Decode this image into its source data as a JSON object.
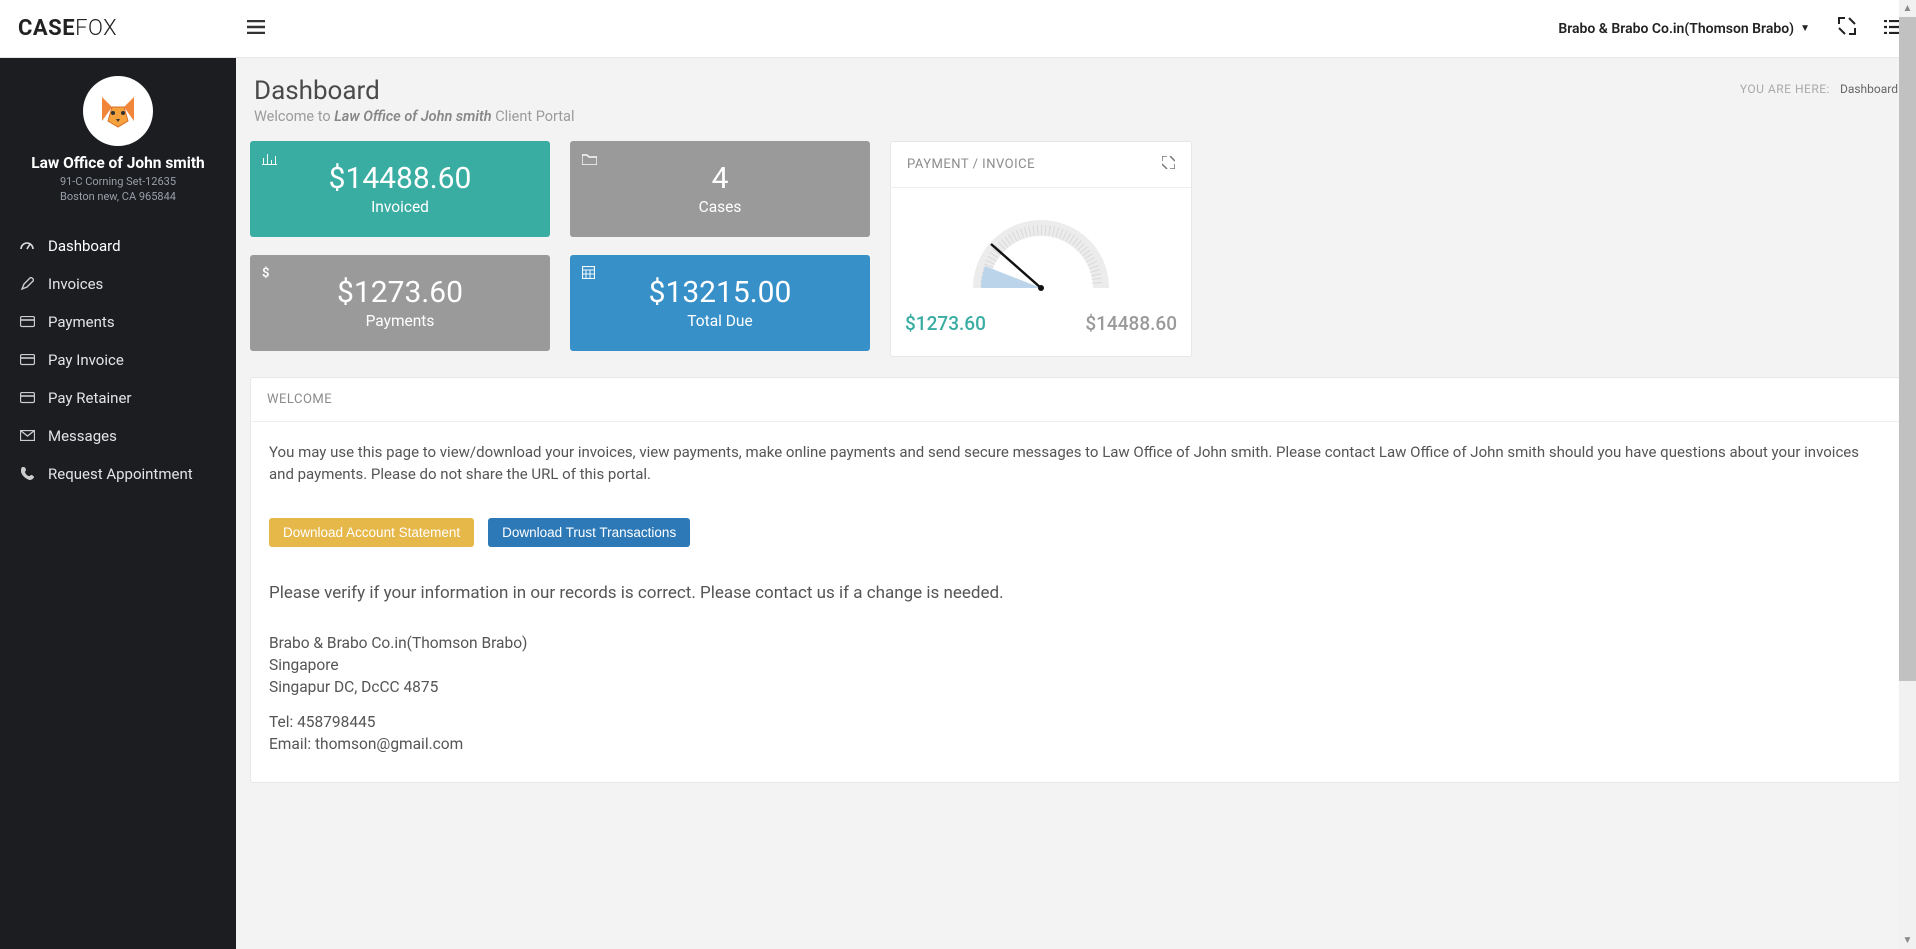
{
  "logo": {
    "bold": "CASE",
    "light": "FOX"
  },
  "header": {
    "user_label": "Brabo & Brabo Co.in(Thomson Brabo)"
  },
  "breadcrumb": {
    "label": "YOU ARE HERE:",
    "current": "Dashboard"
  },
  "page": {
    "title": "Dashboard",
    "subtitle_prefix": "Welcome to ",
    "subtitle_firm": "Law Office of John smith",
    "subtitle_suffix": " Client Portal"
  },
  "profile": {
    "firm": "Law Office of John smith",
    "addr1": "91-C Corning Set-12635",
    "addr2": "Boston new, CA 965844"
  },
  "nav": {
    "items": [
      {
        "label": "Dashboard"
      },
      {
        "label": "Invoices"
      },
      {
        "label": "Payments"
      },
      {
        "label": "Pay Invoice"
      },
      {
        "label": "Pay Retainer"
      },
      {
        "label": "Messages"
      },
      {
        "label": "Request Appointment"
      }
    ]
  },
  "stats": {
    "invoiced": {
      "value": "$14488.60",
      "label": "Invoiced"
    },
    "cases": {
      "value": "4",
      "label": "Cases"
    },
    "payments": {
      "value": "$1273.60",
      "label": "Payments"
    },
    "due": {
      "value": "$13215.00",
      "label": "Total Due"
    }
  },
  "gauge": {
    "title": "PAYMENT / INVOICE",
    "paid": "$1273.60",
    "total": "$14488.60"
  },
  "welcome": {
    "title": "WELCOME",
    "body": "You may use this page to view/download your invoices, view payments, make online payments and send secure messages to Law Office of John smith. Please contact Law Office of John smith should you have questions about your invoices and payments. Please do not share the URL of this portal.",
    "btn_statement": "Download Account Statement",
    "btn_trust": "Download Trust Transactions",
    "verify": "Please verify if your information in our records is correct. Please contact us if a change is needed.",
    "contact": {
      "name": "Brabo & Brabo Co.in(Thomson Brabo)",
      "city": "Singapore",
      "region": "Singapur DC, DcCC 4875",
      "tel": "Tel: 458798445",
      "email": "Email: thomson@gmail.com"
    }
  },
  "chart_data": {
    "type": "gauge",
    "title": "PAYMENT / INVOICE",
    "min": 0,
    "max": 14488.6,
    "value": 1273.6,
    "labels": {
      "value": "$1273.60",
      "max": "$14488.60"
    }
  }
}
